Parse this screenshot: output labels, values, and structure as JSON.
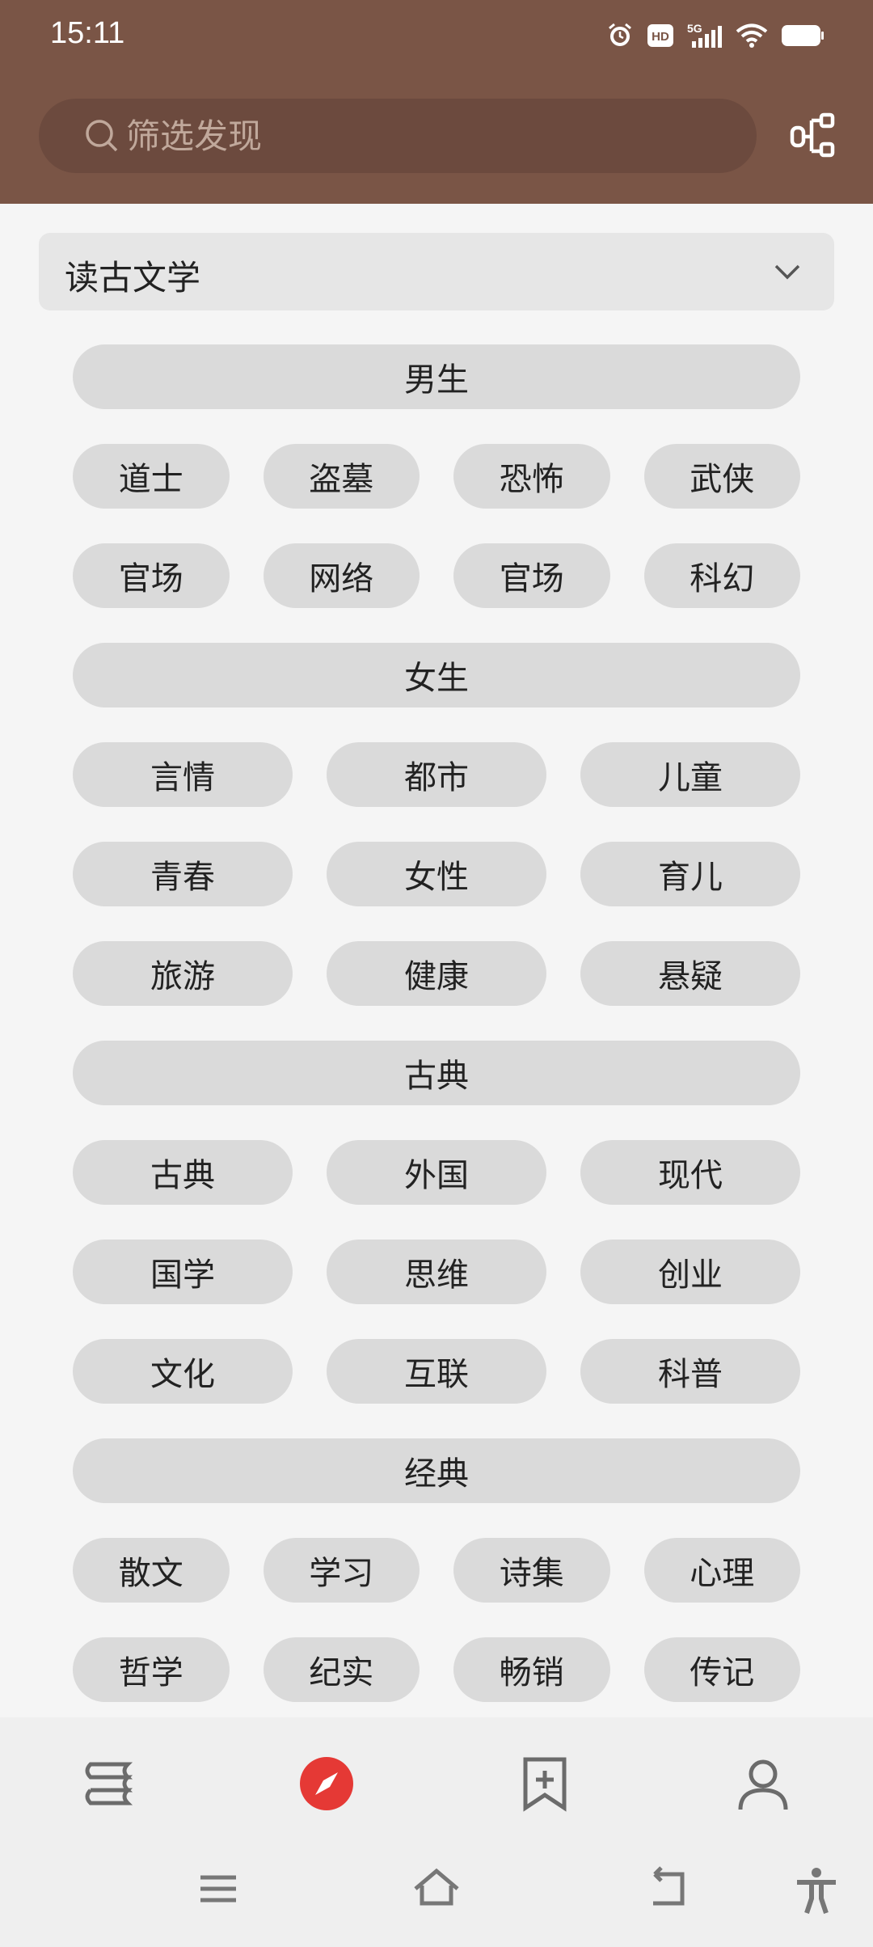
{
  "status": {
    "time": "15:11",
    "network": "5G",
    "hd_badge": "HD"
  },
  "search": {
    "placeholder": "筛选发现"
  },
  "dropdown": {
    "selected": "读古文学"
  },
  "groups": [
    {
      "header": "男生",
      "rows": [
        [
          "道士",
          "盗墓",
          "恐怖",
          "武侠"
        ],
        [
          "官场",
          "网络",
          "官场",
          "科幻"
        ]
      ]
    },
    {
      "header": "女生",
      "rows": [
        [
          "言情",
          "都市",
          "儿童"
        ],
        [
          "青春",
          "女性",
          "育儿"
        ],
        [
          "旅游",
          "健康",
          "悬疑"
        ]
      ]
    },
    {
      "header": "古典",
      "rows": [
        [
          "古典",
          "外国",
          "现代"
        ],
        [
          "国学",
          "思维",
          "创业"
        ],
        [
          "文化",
          "互联",
          "科普"
        ]
      ]
    },
    {
      "header": "经典",
      "rows": [
        [
          "散文",
          "学习",
          "诗集",
          "心理"
        ],
        [
          "哲学",
          "纪实",
          "畅销",
          "传记"
        ]
      ]
    }
  ],
  "bottom_nav": {
    "items": [
      "bookshelf-icon",
      "discover-compass-icon",
      "bookmark-add-icon",
      "profile-icon"
    ],
    "active_index": 1,
    "accent": "#e53935"
  },
  "colors": {
    "header_bg": "#7a5546",
    "search_bg": "#6c4a3e",
    "pill_bg": "#dadada",
    "page_bg": "#f5f5f5"
  }
}
